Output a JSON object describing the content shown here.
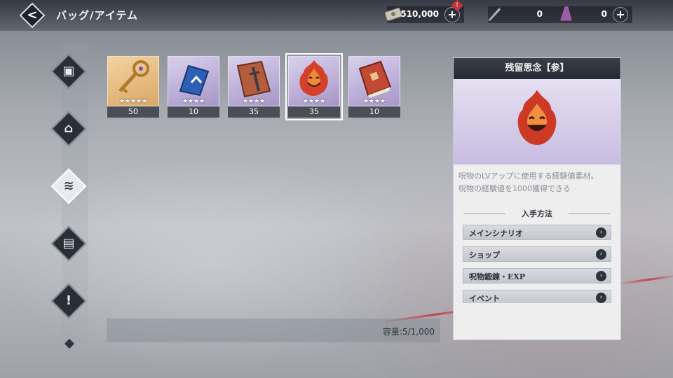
{
  "header": {
    "title": "バッグ/アイテム"
  },
  "currencies": [
    {
      "icon": "banknote-icon",
      "value": "510,000",
      "has_badge": true,
      "badge": "!"
    },
    {
      "icon": "quill-icon",
      "value": "0"
    },
    {
      "icon": "crystal-icon",
      "value": "0"
    }
  ],
  "sidebar": {
    "items": [
      "character",
      "chest",
      "materials",
      "armor",
      "event"
    ],
    "active": 2
  },
  "items": [
    {
      "name": "key",
      "stars": "★★★★★",
      "count": "50",
      "rarity": "gold"
    },
    {
      "name": "scroll",
      "stars": "★★★★",
      "count": "10",
      "rarity": "purple"
    },
    {
      "name": "book-sword",
      "stars": "★★★★",
      "count": "35",
      "rarity": "purple"
    },
    {
      "name": "flame-spirit",
      "stars": "★★★★",
      "count": "35",
      "rarity": "purple",
      "selected": true
    },
    {
      "name": "red-book",
      "stars": "★★★★",
      "count": "10",
      "rarity": "purple"
    }
  ],
  "capacity": "容量:5/1,000",
  "detail": {
    "title": "残留思念【参】",
    "desc_line1": "呪物のLVアップに使用する経験値素材。",
    "desc_line2": "呪物の経験値を1000獲得できる",
    "source_title": "入手方法",
    "sources": [
      "メインシナリオ",
      "ショップ",
      "呪物鍛錬・EXP",
      "イベント"
    ]
  },
  "colors": {
    "accent_red": "#c8323a",
    "panel_dark": "#262a32",
    "rarity_purple": "#a696c9",
    "rarity_gold": "#d9a767"
  }
}
